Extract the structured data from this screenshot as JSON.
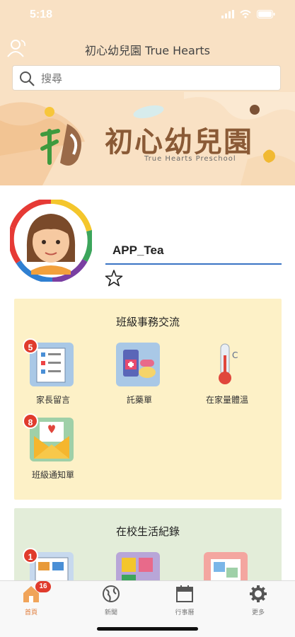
{
  "status_bar": {
    "time": "5:18"
  },
  "header": {
    "title": "初心幼兒園 True Hearts"
  },
  "search": {
    "placeholder": "搜尋"
  },
  "banner": {
    "title": "初心幼兒園",
    "subtitle": "True Hearts Preschool"
  },
  "user": {
    "name": "APP_Tea"
  },
  "section_class": {
    "title": "班級事務交流",
    "items": [
      {
        "label": "家長留言",
        "badge": "5",
        "icon": "message-board-icon"
      },
      {
        "label": "託藥單",
        "badge": "",
        "icon": "medicine-icon"
      },
      {
        "label": "在家量體溫",
        "badge": "",
        "icon": "thermometer-icon"
      },
      {
        "label": "班級通知單",
        "badge": "8",
        "icon": "notice-envelope-icon"
      }
    ]
  },
  "section_school": {
    "title": "在校生活紀錄",
    "items": [
      {
        "badge": "1",
        "icon": "record-book-icon"
      },
      {
        "badge": "",
        "icon": "activity-icon"
      },
      {
        "badge": "",
        "icon": "photo-album-icon"
      }
    ]
  },
  "tabbar": {
    "items": [
      {
        "label": "首頁",
        "badge": "16",
        "icon": "home-icon"
      },
      {
        "label": "新聞",
        "icon": "globe-icon"
      },
      {
        "label": "行事曆",
        "icon": "calendar-icon"
      },
      {
        "label": "更多",
        "icon": "gear-icon"
      }
    ]
  },
  "colors": {
    "header_bg": "#f9e1c4",
    "section_class_bg": "#fdf1c7",
    "section_school_bg": "#e3edd9",
    "accent_blue": "#3a74c4",
    "badge_red": "#e03b2c",
    "active_tab": "#e07b39"
  }
}
